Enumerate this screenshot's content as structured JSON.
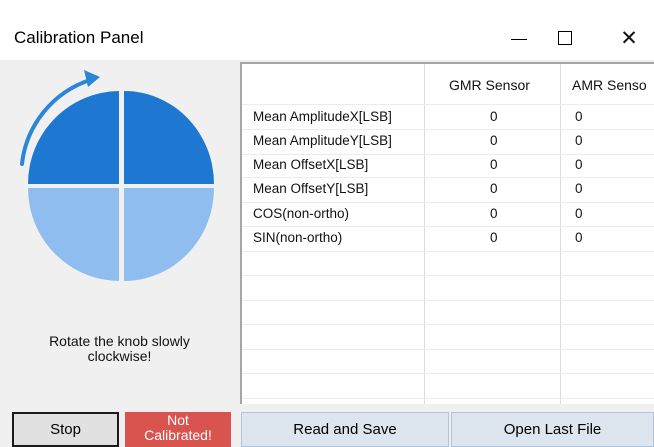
{
  "window": {
    "title": "Calibration Panel",
    "controls": {
      "minimize": "minimize-icon",
      "maximize": "maximize-icon",
      "close": "close-icon"
    }
  },
  "knob": {
    "icon": "rotate-clockwise-knob-icon",
    "colors": {
      "top": "#1e78d2",
      "bottom": "#8fbdf0",
      "arrow": "#2a86d9"
    }
  },
  "instruction": {
    "line1": "Rotate the knob slowly",
    "line2": "clockwise!"
  },
  "grid": {
    "columns": [
      "GMR Sensor",
      "AMR Senso"
    ],
    "rows": [
      {
        "label": "Mean AmplitudeX[LSB]",
        "gmr": "0",
        "amr": "0"
      },
      {
        "label": "Mean AmplitudeY[LSB]",
        "gmr": "0",
        "amr": "0"
      },
      {
        "label": "Mean OffsetX[LSB]",
        "gmr": "0",
        "amr": "0"
      },
      {
        "label": "Mean OffsetY[LSB]",
        "gmr": "0",
        "amr": "0"
      },
      {
        "label": "COS(non-ortho)",
        "gmr": "0",
        "amr": "0"
      },
      {
        "label": "SIN(non-ortho)",
        "gmr": "0",
        "amr": "0"
      }
    ]
  },
  "buttons": {
    "stop": "Stop",
    "status_line1": "Not",
    "status_line2": "Calibrated!",
    "read_save": "Read and Save",
    "open_last": "Open Last File"
  },
  "colors": {
    "status_bg": "#d9534f",
    "action_bg": "#dde6ef"
  }
}
